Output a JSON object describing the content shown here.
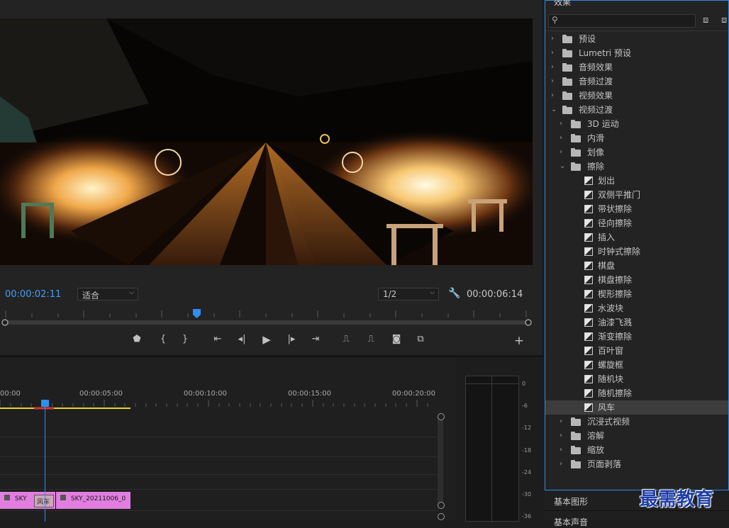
{
  "monitor": {
    "current_time": "00:00:02:11",
    "fit_value": "适合",
    "resolution_value": "1/2",
    "duration": "00:00:06:14",
    "add_button": "+"
  },
  "timeline": {
    "ruler_labels": [
      "00:00",
      "00:00:05:00",
      "00:00:10:00",
      "00:00:15:00",
      "00:00:20:00"
    ],
    "clip1_label": "SKY",
    "transition_label": "风车",
    "clip2_label": "SKY_20211006_0"
  },
  "meters": {
    "db_labels": [
      "0",
      "-6",
      "-12",
      "-18",
      "-24",
      "-30",
      "-36"
    ]
  },
  "effects": {
    "panel_title": "效果",
    "search_placeholder": "",
    "tree": [
      {
        "label": "预设",
        "level": 0,
        "kind": "folder-star",
        "expanded": false
      },
      {
        "label": "Lumetri 预设",
        "level": 0,
        "kind": "folder-star",
        "expanded": false
      },
      {
        "label": "音频效果",
        "level": 0,
        "kind": "folder",
        "expanded": false
      },
      {
        "label": "音频过渡",
        "level": 0,
        "kind": "folder",
        "expanded": false
      },
      {
        "label": "视频效果",
        "level": 0,
        "kind": "folder",
        "expanded": false
      },
      {
        "label": "视频过渡",
        "level": 0,
        "kind": "folder",
        "expanded": true
      },
      {
        "label": "3D 运动",
        "level": 1,
        "kind": "folder",
        "expanded": false
      },
      {
        "label": "内滑",
        "level": 1,
        "kind": "folder",
        "expanded": false
      },
      {
        "label": "划像",
        "level": 1,
        "kind": "folder",
        "expanded": false
      },
      {
        "label": "擦除",
        "level": 1,
        "kind": "folder",
        "expanded": true
      },
      {
        "label": "划出",
        "level": 2,
        "kind": "effect"
      },
      {
        "label": "双侧平推门",
        "level": 2,
        "kind": "effect"
      },
      {
        "label": "带状擦除",
        "level": 2,
        "kind": "effect"
      },
      {
        "label": "径向擦除",
        "level": 2,
        "kind": "effect"
      },
      {
        "label": "插入",
        "level": 2,
        "kind": "effect"
      },
      {
        "label": "时钟式擦除",
        "level": 2,
        "kind": "effect"
      },
      {
        "label": "棋盘",
        "level": 2,
        "kind": "effect"
      },
      {
        "label": "棋盘擦除",
        "level": 2,
        "kind": "effect"
      },
      {
        "label": "楔形擦除",
        "level": 2,
        "kind": "effect"
      },
      {
        "label": "水波块",
        "level": 2,
        "kind": "effect"
      },
      {
        "label": "油漆飞溅",
        "level": 2,
        "kind": "effect"
      },
      {
        "label": "渐变擦除",
        "level": 2,
        "kind": "effect"
      },
      {
        "label": "百叶窗",
        "level": 2,
        "kind": "effect"
      },
      {
        "label": "螺旋框",
        "level": 2,
        "kind": "effect"
      },
      {
        "label": "随机块",
        "level": 2,
        "kind": "effect"
      },
      {
        "label": "随机擦除",
        "level": 2,
        "kind": "effect"
      },
      {
        "label": "风车",
        "level": 2,
        "kind": "effect",
        "selected": true
      },
      {
        "label": "沉浸式视频",
        "level": 1,
        "kind": "folder",
        "expanded": false
      },
      {
        "label": "溶解",
        "level": 1,
        "kind": "folder",
        "expanded": false
      },
      {
        "label": "缩放",
        "level": 1,
        "kind": "folder",
        "expanded": false
      },
      {
        "label": "页面剥落",
        "level": 1,
        "kind": "folder",
        "expanded": false
      }
    ]
  },
  "bottom_panel": {
    "title": "基本图形",
    "next_title": "基本声音"
  },
  "watermark": "最需教育",
  "colors": {
    "accent_blue": "#2d8ceb",
    "timecode_blue": "#3ea1f7",
    "clip_pink": "#e27ee0",
    "playhead_blue": "#2f8ff0",
    "work_area_yellow": "#e3d531"
  }
}
